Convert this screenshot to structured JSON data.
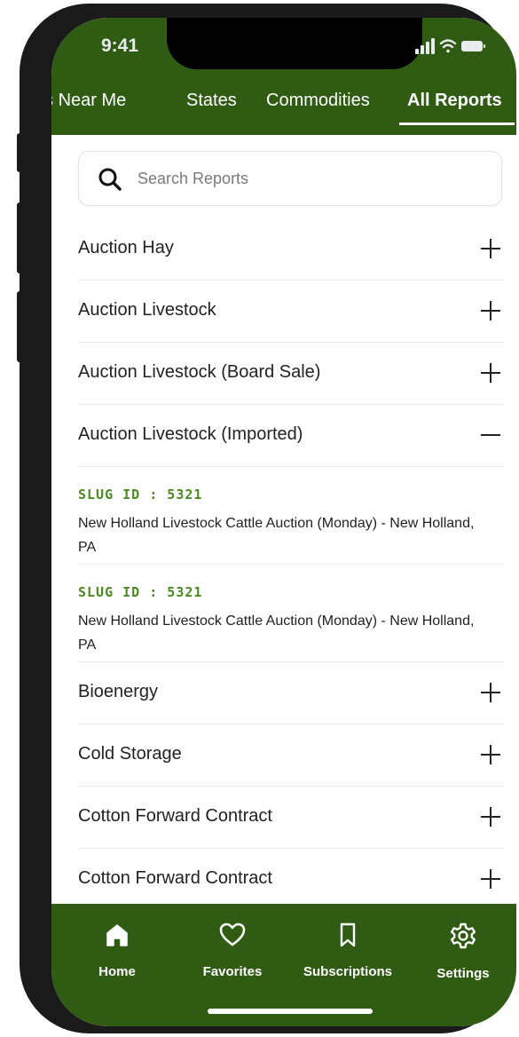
{
  "status_bar": {
    "time": "9:41",
    "icons": [
      "signal-icon",
      "wifi-icon",
      "battery-icon"
    ]
  },
  "tabs": [
    {
      "label": "Reports Near Me",
      "active": false
    },
    {
      "label": "States",
      "active": false
    },
    {
      "label": "Commodities",
      "active": false
    },
    {
      "label": "All Reports",
      "active": true
    }
  ],
  "search": {
    "placeholder": "Search Reports",
    "value": ""
  },
  "list": {
    "items": [
      {
        "label": "Auction Hay",
        "expanded": false,
        "icon": "plus-icon"
      },
      {
        "label": "Auction Livestock",
        "expanded": false,
        "icon": "plus-icon"
      },
      {
        "label": "Auction Livestock (Board Sale)",
        "expanded": false,
        "icon": "plus-icon"
      },
      {
        "label": "Auction Livestock (Imported)",
        "expanded": true,
        "icon": "minus-icon"
      },
      {
        "label": "Bioenergy",
        "expanded": false,
        "icon": "plus-icon"
      },
      {
        "label": "Cold Storage",
        "expanded": false,
        "icon": "plus-icon"
      },
      {
        "label": "Cotton Forward Contract",
        "expanded": false,
        "icon": "plus-icon"
      },
      {
        "label": "Cotton Forward Contract",
        "expanded": false,
        "icon": "plus-icon"
      }
    ],
    "sub_items": [
      {
        "slug": "SLUG ID : 5321",
        "text": "New Holland Livestock Cattle Auction (Monday) - New Holland, PA"
      },
      {
        "slug": "SLUG ID : 5321",
        "text": "New Holland Livestock Cattle Auction (Monday) - New Holland, PA"
      }
    ]
  },
  "bottom_nav": [
    {
      "label": "Home",
      "icon": "home-icon"
    },
    {
      "label": "Favorites",
      "icon": "heart-icon"
    },
    {
      "label": "Subscriptions",
      "icon": "bookmark-icon"
    },
    {
      "label": "Settings",
      "icon": "gear-icon"
    }
  ],
  "colors": {
    "brand_green": "#2f5b13",
    "slug_green": "#4a8a20",
    "text": "#222222",
    "divider": "#e6e8eb"
  }
}
